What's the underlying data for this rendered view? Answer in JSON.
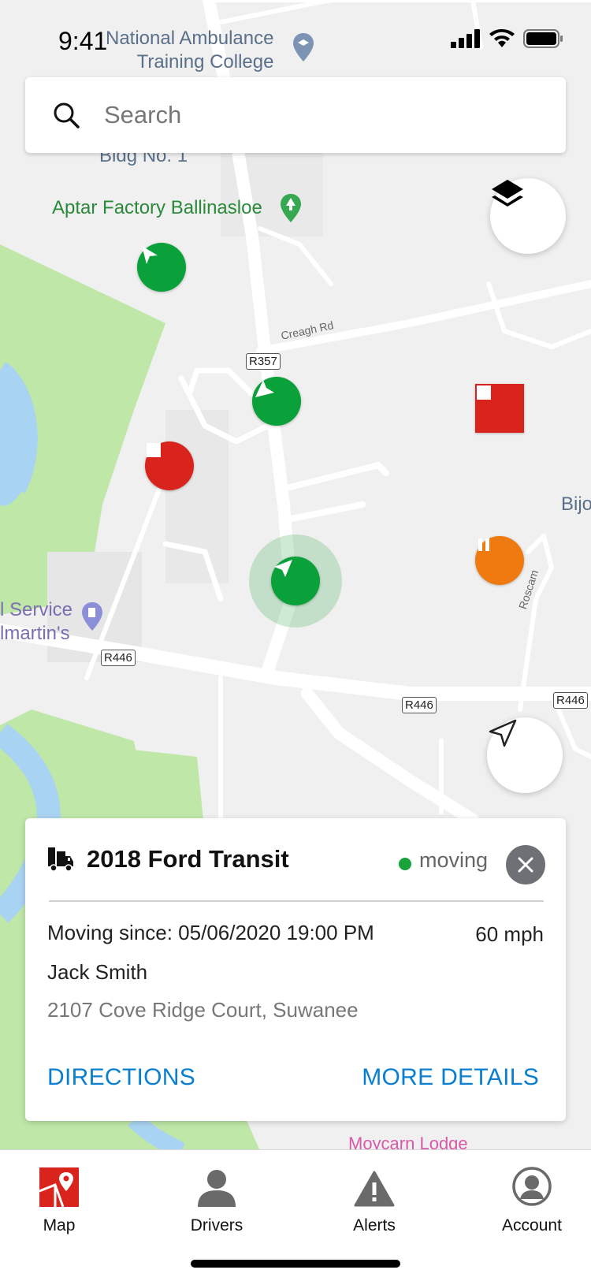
{
  "status_bar": {
    "time": "9:41"
  },
  "search": {
    "placeholder": "Search"
  },
  "map": {
    "labels": {
      "college": "National Ambulance\nTraining College",
      "bldg": "Bldg No. 1",
      "factory": "Aptar Factory Ballinasloe",
      "creagh": "Creagh Rd",
      "r357": "R357",
      "r446_a": "R446",
      "r446_b": "R446",
      "r446_c": "R446",
      "service": "l Service",
      "martins": "lmartin's",
      "bijo": "Bijo",
      "roscam": "Roscam",
      "lodge": "Moycarn Lodge"
    },
    "markers": [
      {
        "status": "moving",
        "color": "#0aa03a"
      },
      {
        "status": "moving",
        "color": "#0aa03a"
      },
      {
        "status": "moving",
        "color": "#0aa03a",
        "selected": true
      },
      {
        "status": "stopped",
        "color": "#d8241c"
      },
      {
        "status": "stopped",
        "color": "#d8241c"
      },
      {
        "status": "idle",
        "color": "#ee7a10"
      }
    ]
  },
  "vehicle_card": {
    "title": "2018 Ford Transit",
    "status": "moving",
    "status_color": "#1aa33b",
    "moving_since": "Moving since: 05/06/2020 19:00 PM",
    "speed": "60 mph",
    "driver": "Jack Smith",
    "address": "2107 Cove Ridge Court, Suwanee",
    "directions_label": "DIRECTIONS",
    "details_label": "MORE DETAILS"
  },
  "tabbar": {
    "items": [
      {
        "label": "Map",
        "icon": "map-icon",
        "active": true
      },
      {
        "label": "Drivers",
        "icon": "driver-icon"
      },
      {
        "label": "Alerts",
        "icon": "alert-icon"
      },
      {
        "label": "Account",
        "icon": "account-icon"
      }
    ]
  },
  "colors": {
    "accent": "#0a7fd0",
    "brand_red": "#d8241c",
    "moving": "#0aa03a",
    "idle": "#ee7a10"
  }
}
